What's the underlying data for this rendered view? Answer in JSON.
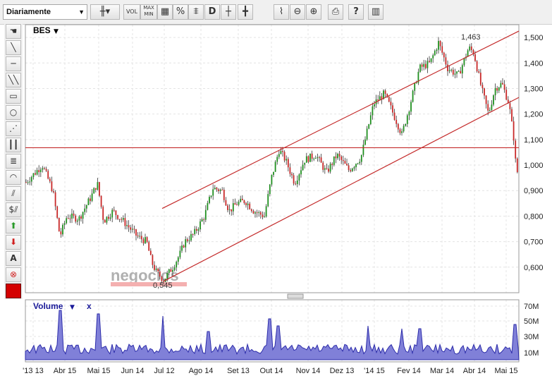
{
  "toolbar": {
    "period_select": "Diariamente",
    "vol_label": "VOL",
    "maxmin_label": "MAX MIN",
    "percent_label": "%",
    "d_label": "D"
  },
  "chart": {
    "symbol": "BES",
    "symbol_arrow": "▼",
    "high_label": "1,463",
    "low_label": "0,545",
    "watermark": "negocios",
    "y_ticks": [
      "1,500",
      "1,400",
      "1,300",
      "1,200",
      "1,100",
      "1,000",
      "0,900",
      "0,800",
      "0,700",
      "0,600"
    ],
    "x_ticks": [
      "'13 13",
      "Abr 15",
      "Mai 15",
      "Jun 14",
      "Jul 12",
      "Ago 14",
      "Set 13",
      "Out 14",
      "Nov 14",
      "Dez 13",
      "'14 15",
      "Fev 14",
      "Mar 14",
      "Abr 14",
      "Mai 15"
    ]
  },
  "volume": {
    "label": "Volume",
    "arrow": "▼",
    "close": "x",
    "y_ticks": [
      "70M",
      "50M",
      "30M",
      "10M"
    ]
  },
  "chart_data": {
    "type": "candlestick",
    "y_axis_range": [
      0.5,
      1.55
    ],
    "series": [
      {
        "name": "BES",
        "x": [
          "2013-01-01",
          "2013-04-15",
          "2013-05-15",
          "2013-06-14",
          "2013-07-12",
          "2013-08-14",
          "2013-09-13",
          "2013-10-14",
          "2013-11-14",
          "2013-12-13",
          "2014-01-15",
          "2014-02-14",
          "2014-03-14",
          "2014-04-14",
          "2014-05-15",
          "2014-05-21"
        ],
        "close": [
          0.95,
          0.76,
          0.8,
          0.72,
          0.55,
          0.8,
          0.83,
          1.06,
          0.98,
          1.02,
          1.25,
          1.1,
          1.42,
          1.45,
          1.27,
          1.0
        ]
      }
    ],
    "annotations": [
      {
        "label": "1,463",
        "value": 1.463
      },
      {
        "label": "0,545",
        "value": 0.545
      }
    ]
  }
}
